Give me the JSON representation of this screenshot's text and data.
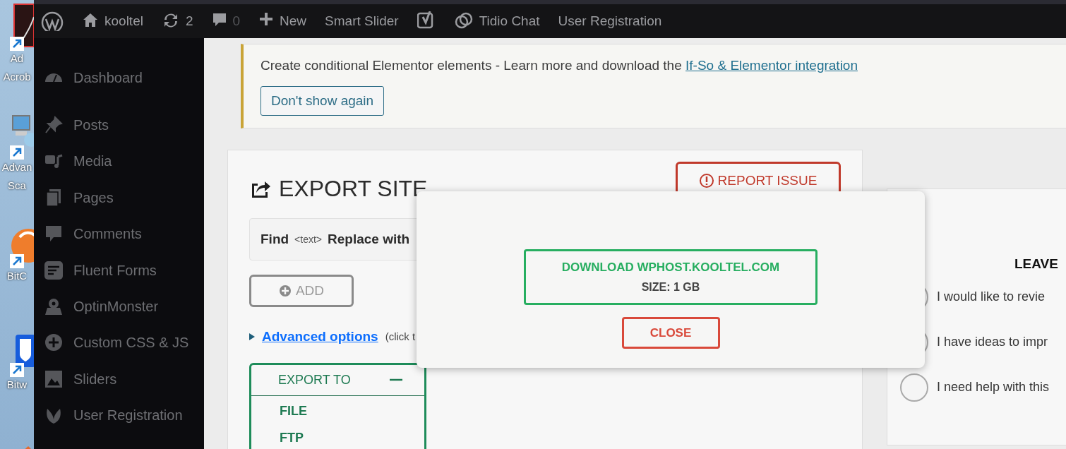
{
  "desktop_icons": [
    {
      "kind": "acrobat",
      "lines": [
        "Ad",
        "Acrob"
      ]
    },
    {
      "kind": "computer",
      "lines": [
        "Advan",
        "Sca"
      ]
    },
    {
      "kind": "bitcoin",
      "lines": [
        "BitC"
      ]
    },
    {
      "kind": "shield",
      "lines": [
        "Bitw"
      ]
    },
    {
      "kind": "partial"
    }
  ],
  "admin_bar": {
    "items": [
      {
        "kind": "wp"
      },
      {
        "kind": "home",
        "label": "kooltel"
      },
      {
        "kind": "updates",
        "label": "2"
      },
      {
        "kind": "comments",
        "label": "0"
      },
      {
        "kind": "new",
        "label": "New"
      },
      {
        "kind": "text",
        "label": "Smart Slider"
      },
      {
        "kind": "yoast"
      },
      {
        "kind": "tidio",
        "label": "Tidio Chat"
      },
      {
        "kind": "text",
        "label": "User Registration"
      }
    ]
  },
  "sidebar": {
    "items": [
      {
        "kind": "dashboard",
        "label": "Dashboard"
      },
      {
        "kind": "pin",
        "label": "Posts"
      },
      {
        "kind": "media",
        "label": "Media"
      },
      {
        "kind": "pages",
        "label": "Pages"
      },
      {
        "kind": "comment",
        "label": "Comments"
      },
      {
        "kind": "forms",
        "label": "Fluent Forms"
      },
      {
        "kind": "monster",
        "label": "OptinMonster"
      },
      {
        "kind": "plus",
        "label": "Custom CSS & JS"
      },
      {
        "kind": "image",
        "label": "Sliders"
      },
      {
        "kind": "leaf",
        "label": "User Registration"
      }
    ]
  },
  "notice": {
    "text": "Create conditional Elementor elements - Learn more and download the",
    "link": "If-So & Elementor integration",
    "button": "Don't show again"
  },
  "export": {
    "title": "EXPORT SITE",
    "report_button": "REPORT ISSUE",
    "find_label": "Find",
    "find_placeholder": "<text>",
    "replace_label": "Replace with",
    "add_button": "ADD",
    "advanced": "Advanced options",
    "advanced_note": "(click t",
    "export_to": {
      "title": "EXPORT TO",
      "expanded": true,
      "options": [
        "FILE",
        "FTP"
      ]
    }
  },
  "feedback": {
    "title": "LEAVE",
    "options": [
      {
        "label": "I would like to revie",
        "selected": false
      },
      {
        "label": "I have ideas to impr",
        "selected": false
      },
      {
        "label": "I need help with this",
        "selected": false
      }
    ]
  },
  "modal": {
    "download": "DOWNLOAD WPHOST.KOOLTEL.COM",
    "size": "SIZE: 1 GB",
    "close": "CLOSE"
  }
}
